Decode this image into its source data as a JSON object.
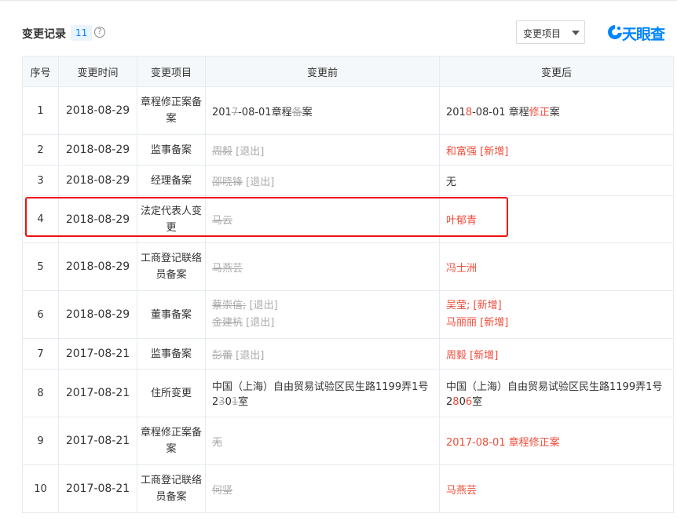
{
  "header": {
    "title": "变更记录",
    "count": "11",
    "help_icon": "?",
    "filter_label": "变更项目",
    "logo_text": "天眼查"
  },
  "columns": [
    "序号",
    "变更时间",
    "变更项目",
    "变更前",
    "变更后"
  ],
  "rows": [
    {
      "no": "1",
      "date": "2018-08-29",
      "item": "章程修正案备案",
      "before": {
        "parts": [
          {
            "t": "201",
            "x": false
          },
          {
            "t": "7",
            "x": true
          },
          {
            "t": "-08-01章程",
            "x": false
          },
          {
            "t": "备",
            "x": true
          },
          {
            "t": "案",
            "x": false
          }
        ]
      },
      "after": {
        "parts": [
          {
            "t": "201",
            "h": false
          },
          {
            "t": "8",
            "h": true
          },
          {
            "t": "-08-01 章程",
            "h": false
          },
          {
            "t": "修正",
            "h": true
          },
          {
            "t": "案",
            "h": false
          }
        ]
      }
    },
    {
      "no": "2",
      "date": "2018-08-29",
      "item": "监事备案",
      "before": {
        "name": "周毅",
        "tag": " [退出]"
      },
      "after": {
        "name": "和富强",
        "tag": " [新增]"
      }
    },
    {
      "no": "3",
      "date": "2018-08-29",
      "item": "经理备案",
      "before": {
        "name": "邵晓锋",
        "tag": " [退出]"
      },
      "after": {
        "text": "无"
      }
    },
    {
      "no": "4",
      "date": "2018-08-29",
      "item": "法定代表人变更",
      "before": {
        "name": "马云"
      },
      "after": {
        "name": "叶郁青"
      }
    },
    {
      "no": "5",
      "date": "2018-08-29",
      "item": "工商登记联络员备案",
      "before": {
        "name": "马燕芸"
      },
      "after": {
        "name": "冯士洲"
      }
    },
    {
      "no": "6",
      "date": "2018-08-29",
      "item": "董事备案",
      "before": {
        "lines": [
          {
            "name": "蔡崇信;",
            "tag": " [退出]"
          },
          {
            "name": "金建杭",
            "tag": " [退出]"
          }
        ]
      },
      "after": {
        "lines": [
          {
            "name": "吴莹;",
            "tag": " [新增]"
          },
          {
            "name": "马丽丽",
            "tag": " [新增]"
          }
        ]
      }
    },
    {
      "no": "7",
      "date": "2017-08-21",
      "item": "监事备案",
      "before": {
        "name": "彭蕾",
        "tag": " [退出]"
      },
      "after": {
        "name": "周毅",
        "tag": " [新增]"
      }
    },
    {
      "no": "8",
      "date": "2017-08-21",
      "item": "住所变更",
      "before": {
        "parts": [
          {
            "t": "中国（上海）自由贸易试验区民生路1199弄1号2",
            "x": false
          },
          {
            "t": "3",
            "x": true
          },
          {
            "t": "0",
            "x": false
          },
          {
            "t": "1",
            "x": true
          },
          {
            "t": "室",
            "x": false
          }
        ]
      },
      "after": {
        "parts": [
          {
            "t": "中国（上海）自由贸易试验区民生路1199弄1号2",
            "h": false
          },
          {
            "t": "8",
            "h": true
          },
          {
            "t": "0",
            "h": false
          },
          {
            "t": "6",
            "h": true
          },
          {
            "t": "室",
            "h": false
          }
        ]
      }
    },
    {
      "no": "9",
      "date": "2017-08-21",
      "item": "章程修正案备案",
      "before": {
        "name": "无"
      },
      "after": {
        "name": "2017-08-01 章程修正案"
      }
    },
    {
      "no": "10",
      "date": "2017-08-21",
      "item": "工商登记联络员备案",
      "before": {
        "name": "何坚"
      },
      "after": {
        "name": "马燕芸"
      }
    }
  ],
  "colors": {
    "accent": "#0084ff",
    "removed": "#aaaaaa",
    "added": "#f04d3b",
    "highlight_box": "#ee1111"
  }
}
